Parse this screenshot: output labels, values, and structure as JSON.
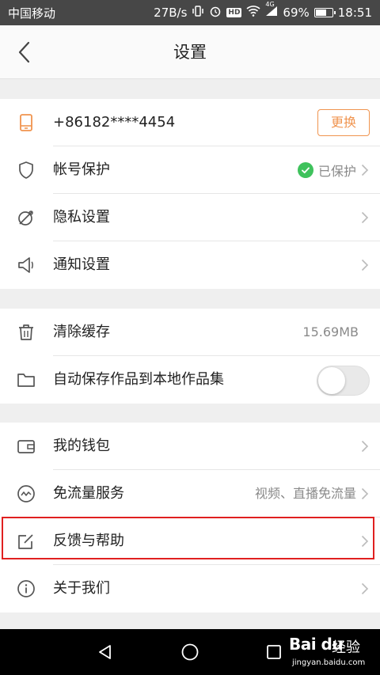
{
  "status_bar": {
    "carrier": "中国移动",
    "speed": "27B/s",
    "battery_percent": "69%",
    "battery_level": 0.69,
    "time": "18:51",
    "hd_badge": "HD",
    "network_badge": "4G"
  },
  "header": {
    "title": "设置",
    "back_icon": "chevron-left-icon"
  },
  "account": {
    "phone": "+86182****4454",
    "change_label": "更换",
    "protect_label": "帐号保护",
    "protect_status": "已保护",
    "privacy_label": "隐私设置",
    "notify_label": "通知设置"
  },
  "storage": {
    "clear_cache_label": "清除缓存",
    "cache_size": "15.69MB",
    "auto_save_label": "自动保存作品到本地作品集",
    "auto_save_on": false
  },
  "services": {
    "wallet_label": "我的钱包",
    "free_traffic_label": "免流量服务",
    "free_traffic_value": "视频、直播免流量",
    "feedback_label": "反馈与帮助",
    "about_label": "关于我们"
  },
  "watermark": {
    "logo": "Bai du",
    "cn": "经验",
    "url": "jingyan.baidu.com"
  },
  "colors": {
    "accent": "#f0944f",
    "check_green": "#3fc25c",
    "highlight_red": "#e02020"
  }
}
